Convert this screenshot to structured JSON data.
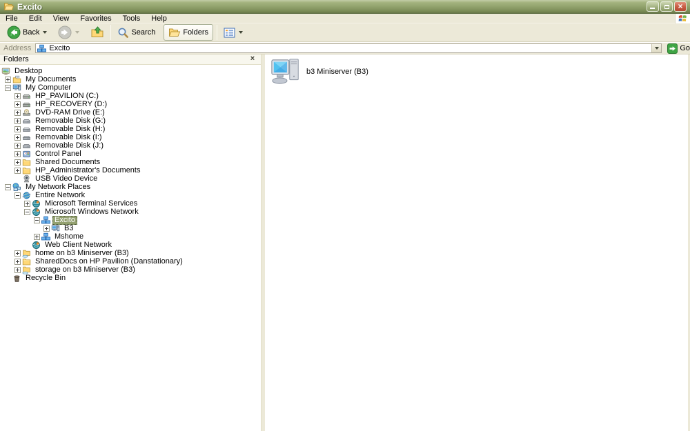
{
  "window": {
    "title": "Excito",
    "buttons": {
      "minimize": "minimize",
      "restore": "restore",
      "close": "close"
    }
  },
  "menubar": {
    "items": [
      "File",
      "Edit",
      "View",
      "Favorites",
      "Tools",
      "Help"
    ]
  },
  "toolbar": {
    "back_label": "Back",
    "search_label": "Search",
    "folders_label": "Folders"
  },
  "addressbar": {
    "label": "Address",
    "value": "Excito",
    "icon": "workgroup",
    "go_label": "Go"
  },
  "folders_panel": {
    "title": "Folders",
    "tree": [
      {
        "label": "Desktop",
        "level": 0,
        "expander": "none",
        "icon": "desktop"
      },
      {
        "label": "My Documents",
        "level": 1,
        "expander": "plus",
        "icon": "folder-docs"
      },
      {
        "label": "My Computer",
        "level": 1,
        "expander": "minus",
        "icon": "computer"
      },
      {
        "label": "HP_PAVILION (C:)",
        "level": 2,
        "expander": "plus",
        "icon": "drive"
      },
      {
        "label": "HP_RECOVERY (D:)",
        "level": 2,
        "expander": "plus",
        "icon": "drive"
      },
      {
        "label": "DVD-RAM Drive (E:)",
        "level": 2,
        "expander": "plus",
        "icon": "cd-drive"
      },
      {
        "label": "Removable Disk (G:)",
        "level": 2,
        "expander": "plus",
        "icon": "removable"
      },
      {
        "label": "Removable Disk (H:)",
        "level": 2,
        "expander": "plus",
        "icon": "removable"
      },
      {
        "label": "Removable Disk (I:)",
        "level": 2,
        "expander": "plus",
        "icon": "removable"
      },
      {
        "label": "Removable Disk (J:)",
        "level": 2,
        "expander": "plus",
        "icon": "removable"
      },
      {
        "label": "Control Panel",
        "level": 2,
        "expander": "plus",
        "icon": "control-panel"
      },
      {
        "label": "Shared Documents",
        "level": 2,
        "expander": "plus",
        "icon": "folder"
      },
      {
        "label": "HP_Administrator's Documents",
        "level": 2,
        "expander": "plus",
        "icon": "folder"
      },
      {
        "label": "USB Video Device",
        "level": 2,
        "expander": "none",
        "icon": "camera"
      },
      {
        "label": "My Network Places",
        "level": 1,
        "expander": "minus",
        "icon": "network-places"
      },
      {
        "label": "Entire Network",
        "level": 2,
        "expander": "minus",
        "icon": "globe"
      },
      {
        "label": "Microsoft Terminal Services",
        "level": 3,
        "expander": "plus",
        "icon": "net-globe"
      },
      {
        "label": "Microsoft Windows Network",
        "level": 3,
        "expander": "minus",
        "icon": "net-globe"
      },
      {
        "label": "Excito",
        "level": 4,
        "expander": "minus",
        "icon": "workgroup",
        "selected": true
      },
      {
        "label": "B3",
        "level": 5,
        "expander": "plus",
        "icon": "computer"
      },
      {
        "label": "Mshome",
        "level": 4,
        "expander": "plus",
        "icon": "workgroup"
      },
      {
        "label": "Web Client Network",
        "level": 3,
        "expander": "none",
        "icon": "net-globe"
      },
      {
        "label": "home on b3 Miniserver (B3)",
        "level": 2,
        "expander": "plus",
        "icon": "shared-folder"
      },
      {
        "label": "SharedDocs on HP Pavilion (Danstationary)",
        "level": 2,
        "expander": "plus",
        "icon": "folder"
      },
      {
        "label": "storage on b3 Miniserver (B3)",
        "level": 2,
        "expander": "plus",
        "icon": "shared-folder"
      },
      {
        "label": "Recycle Bin",
        "level": 1,
        "expander": "none",
        "icon": "recycle-bin"
      }
    ]
  },
  "content": {
    "items": [
      {
        "label": "b3 Miniserver (B3)",
        "icon": "computer-large"
      }
    ]
  },
  "colors": {
    "titlebar_top": "#c3cda6",
    "titlebar_bottom": "#68784a",
    "face": "#ece9d8",
    "selection": "#93a070",
    "close_button": "#c75b42",
    "go_green": "#3fa444",
    "back_green": "#3fa444"
  }
}
